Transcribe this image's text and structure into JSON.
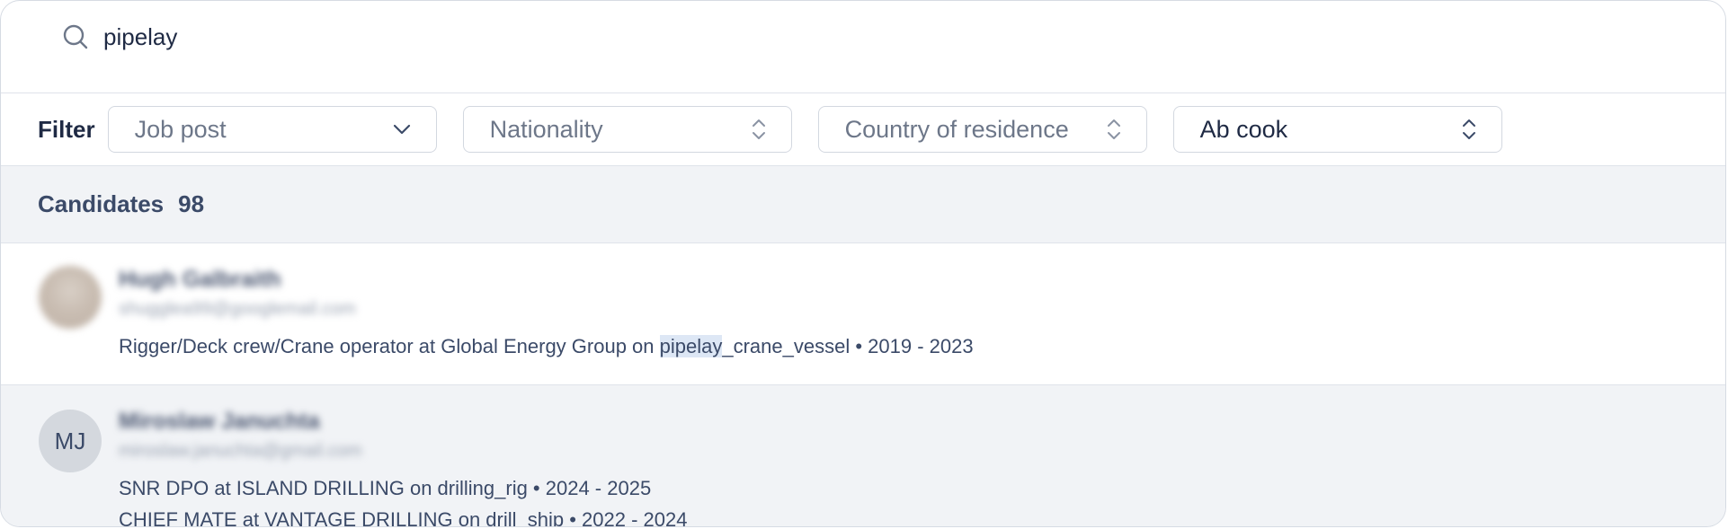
{
  "search": {
    "value": "pipelay"
  },
  "filter": {
    "label": "Filter",
    "selects": [
      {
        "text": "Job post",
        "placeholder": true,
        "icon": "chevron-down-icon"
      },
      {
        "text": "Nationality",
        "placeholder": true,
        "icon": "chevron-up-down-icon"
      },
      {
        "text": "Country of residence",
        "placeholder": true,
        "icon": "chevron-up-down-icon"
      },
      {
        "text": "Ab cook",
        "placeholder": false,
        "icon": "chevron-up-down-icon"
      }
    ]
  },
  "candidates": {
    "title": "Candidates",
    "count": "98",
    "items": [
      {
        "name": "Hugh Galbraith",
        "email": "shugglea99@googlemail.com",
        "avatar": "photo",
        "experience": [
          {
            "pre": "Rigger/Deck crew/Crane operator at Global Energy Group on ",
            "hl": "pipelay",
            "post": "_crane_vessel • 2019 - 2023"
          }
        ]
      },
      {
        "name": "Miroslaw Januchta",
        "email": "miroslaw.januchta@gmail.com",
        "avatar": "initials",
        "initials": "MJ",
        "experience": [
          {
            "text": "SNR DPO at ISLAND DRILLING on drilling_rig • 2024 - 2025"
          },
          {
            "text": "CHIEF MATE at VANTAGE DRILLING on drill_ship • 2022 - 2024"
          }
        ]
      }
    ]
  },
  "colors": {
    "text": "#1f2a44",
    "muted": "#6d7789",
    "highlight": "#dde7f5",
    "header_bg": "#f1f3f6"
  }
}
